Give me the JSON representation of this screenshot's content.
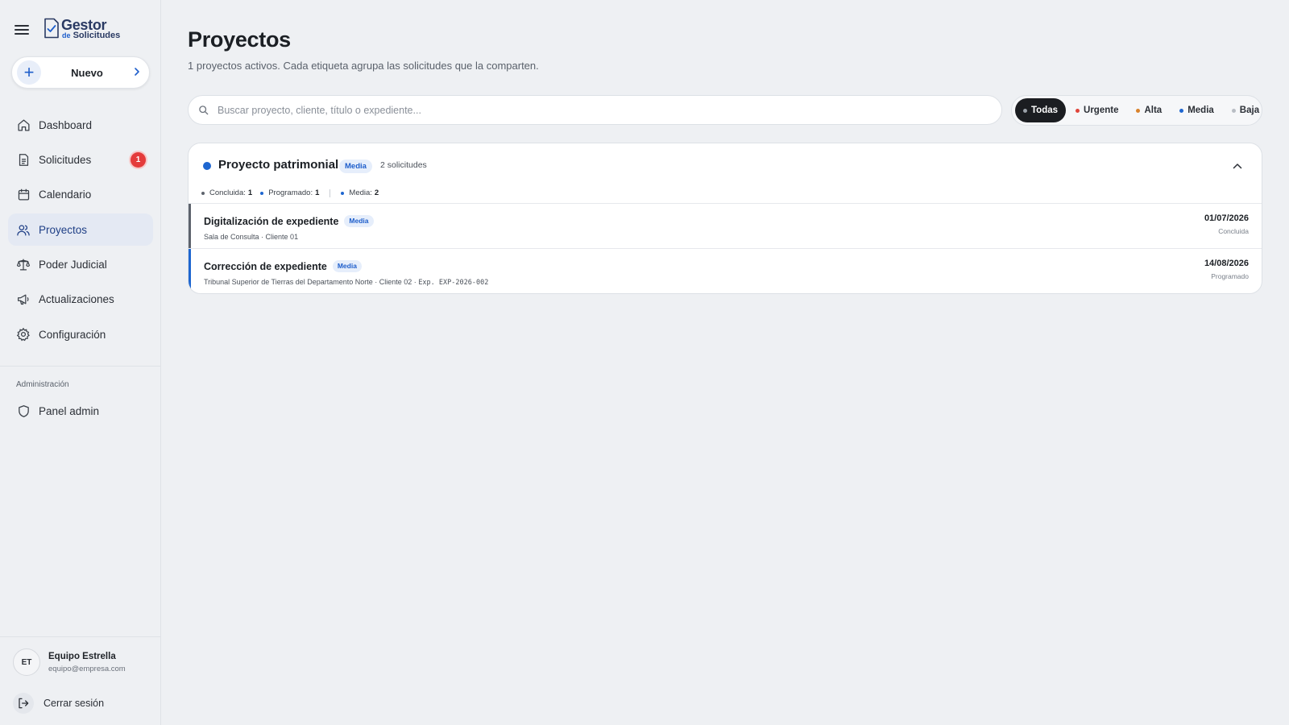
{
  "app": {
    "logo_main": "Gestor",
    "logo_sub_prefix": "de",
    "logo_sub": "Solicitudes"
  },
  "sidebar": {
    "new_button": "Nuevo",
    "items": [
      {
        "label": "Dashboard",
        "icon": "home-icon"
      },
      {
        "label": "Solicitudes",
        "icon": "document-icon",
        "badge": "1"
      },
      {
        "label": "Calendario",
        "icon": "calendar-icon"
      },
      {
        "label": "Proyectos",
        "icon": "users-icon",
        "active": true
      },
      {
        "label": "Poder Judicial",
        "icon": "scale-icon"
      },
      {
        "label": "Actualizaciones",
        "icon": "megaphone-icon"
      },
      {
        "label": "Configuración",
        "icon": "gear-icon"
      }
    ],
    "admin_section": "Administración",
    "admin_items": [
      {
        "label": "Panel admin",
        "icon": "shield-icon"
      }
    ],
    "user": {
      "initials": "ET",
      "name": "Equipo Estrella",
      "email": "equipo@empresa.com"
    },
    "logout": "Cerrar sesión"
  },
  "main": {
    "title": "Proyectos",
    "subtitle": "1 proyectos activos. Cada etiqueta agrupa las solicitudes que la comparten.",
    "search_placeholder": "Buscar proyecto, cliente, título o expediente...",
    "filters": [
      {
        "label": "Todas",
        "color": "#9aa0a8",
        "active": true
      },
      {
        "label": "Urgente",
        "color": "#e0453a"
      },
      {
        "label": "Alta",
        "color": "#d9822b"
      },
      {
        "label": "Media",
        "color": "#1e66d0"
      },
      {
        "label": "Baja",
        "color": "#b8bdc4"
      }
    ],
    "project": {
      "name": "Proyecto patrimonial",
      "priority": "Media",
      "count": "2 solicitudes",
      "dot_color": "#1e66d0",
      "stats": {
        "concluida_label": "Concluida:",
        "concluida_value": "1",
        "programado_label": "Programado:",
        "programado_value": "1",
        "media_label": "Media:",
        "media_value": "2"
      },
      "requests": [
        {
          "title": "Digitalización de expediente",
          "priority": "Media",
          "meta": "Sala de Consulta · Cliente 01",
          "exp": "",
          "date": "01/07/2026",
          "status": "Concluida",
          "bar_color": "#5d636c"
        },
        {
          "title": "Corrección de expediente",
          "priority": "Media",
          "meta": "Tribunal Superior de Tierras del Departamento Norte · Cliente 02 ·",
          "exp": "Exp. EXP-2026-002",
          "date": "14/08/2026",
          "status": "Programado",
          "bar_color": "#1e66d0"
        }
      ]
    }
  }
}
